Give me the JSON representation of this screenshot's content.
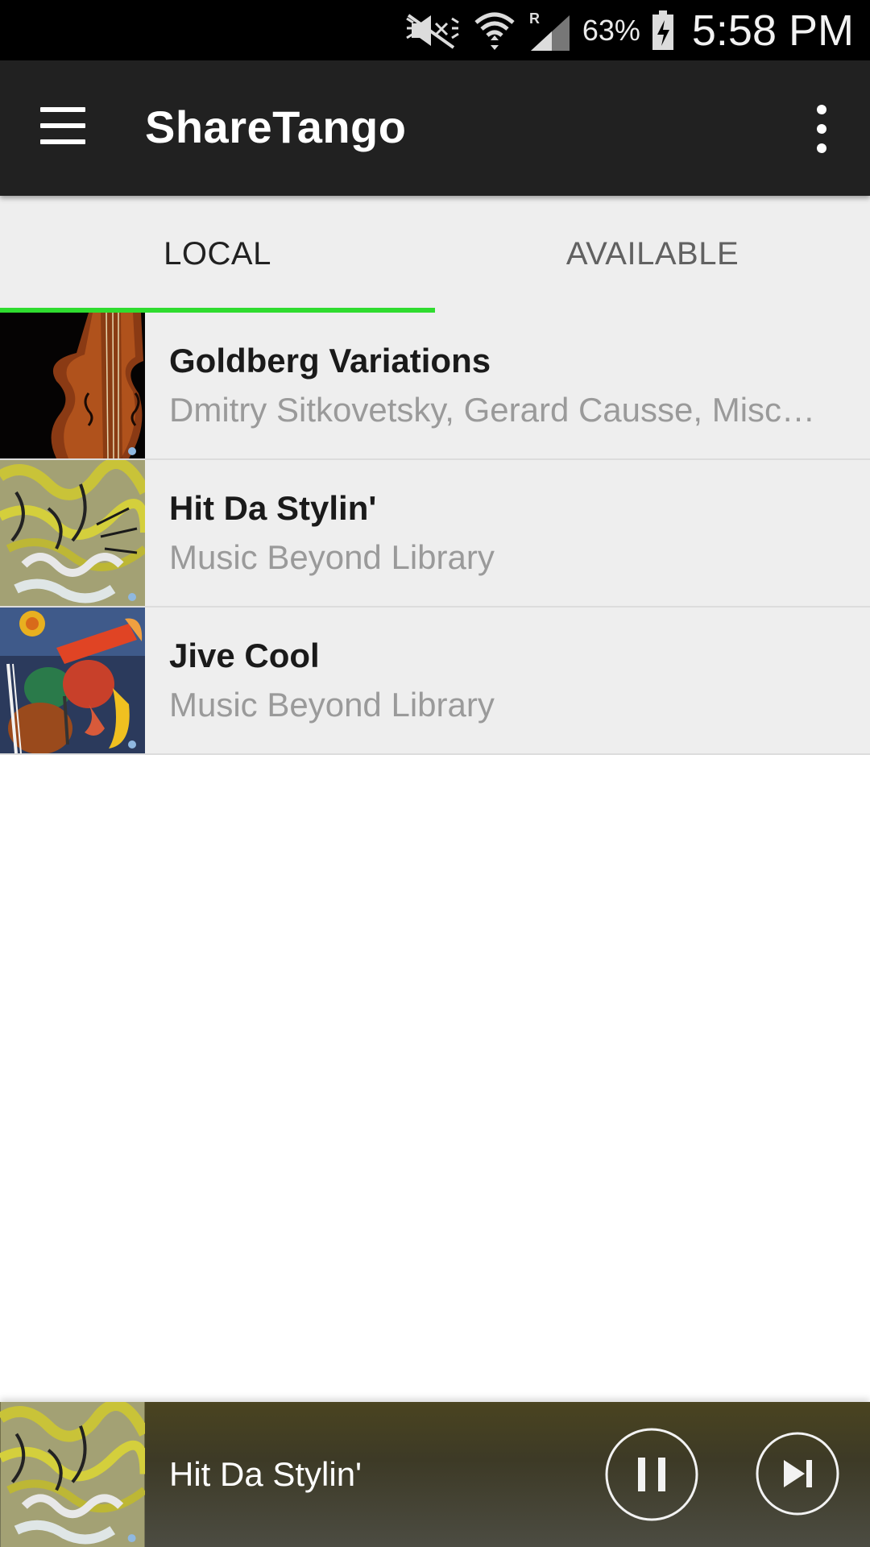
{
  "status_bar": {
    "battery_percent": "63%",
    "time": "5:58 PM",
    "icons": [
      "mute-icon",
      "wifi-icon",
      "signal-roaming-icon",
      "battery-charging-icon"
    ]
  },
  "app_bar": {
    "title": "ShareTango",
    "icons": [
      "menu-icon",
      "overflow-menu-icon"
    ]
  },
  "tabs": [
    {
      "label": "LOCAL",
      "active": true
    },
    {
      "label": "AVAILABLE",
      "active": false
    }
  ],
  "accent_color": "#2fdc2f",
  "albums": [
    {
      "title": "Goldberg Variations",
      "artist": "Dmitry Sitkovetsky, Gerard Causse, Mischa Maisky",
      "art": "violin-album-art"
    },
    {
      "title": "Hit Da Stylin'",
      "artist": "Music Beyond Library",
      "art": "graffiti-album-art"
    },
    {
      "title": "Jive Cool",
      "artist": "Music Beyond Library",
      "art": "jazz-instruments-album-art"
    }
  ],
  "now_playing": {
    "title": "Hit Da Stylin'",
    "icons": [
      "pause-icon",
      "skip-next-icon"
    ]
  }
}
